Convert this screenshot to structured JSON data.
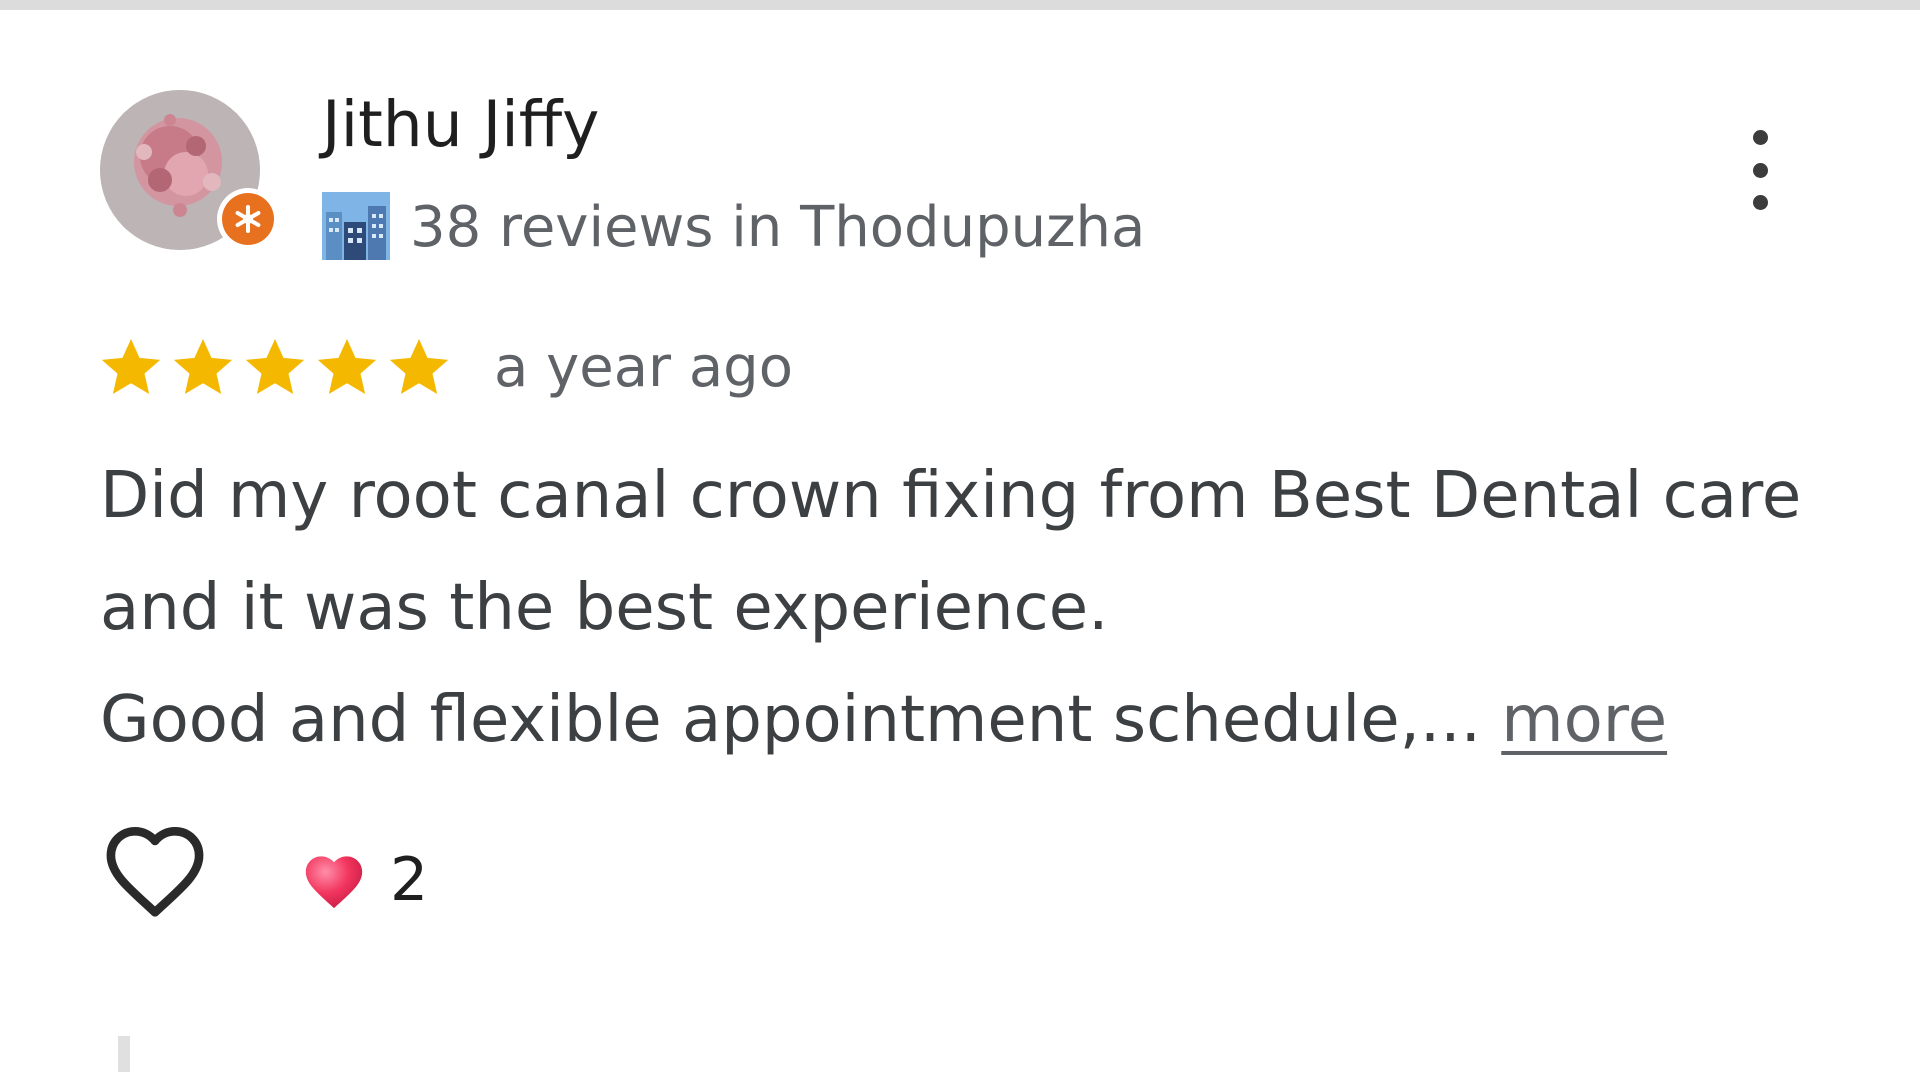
{
  "review": {
    "reviewer_name": "Jithu Jiffy",
    "reviewer_meta": "38 reviews in Thodupuzha",
    "rating": 5,
    "rating_max": 5,
    "time_ago": "a year ago",
    "text_lines": [
      "Did my root canal crown fixing from Best Dental care",
      "and it was the best experience.",
      "Good and flexible  appointment schedule,... "
    ],
    "more_label": "more",
    "reaction_count": "2"
  },
  "icons": {
    "avatar": "avatar-image",
    "badge": "local-guide-badge-icon",
    "city": "city-icon",
    "menu": "more-vert-icon",
    "star": "star-icon",
    "like": "heart-outline-icon",
    "reaction": "heart-emoji-icon"
  },
  "colors": {
    "star": "#f5b800",
    "badge": "#e8711f",
    "name": "#1f1f1f",
    "meta": "#5f6368",
    "body_text": "#3c4043"
  }
}
